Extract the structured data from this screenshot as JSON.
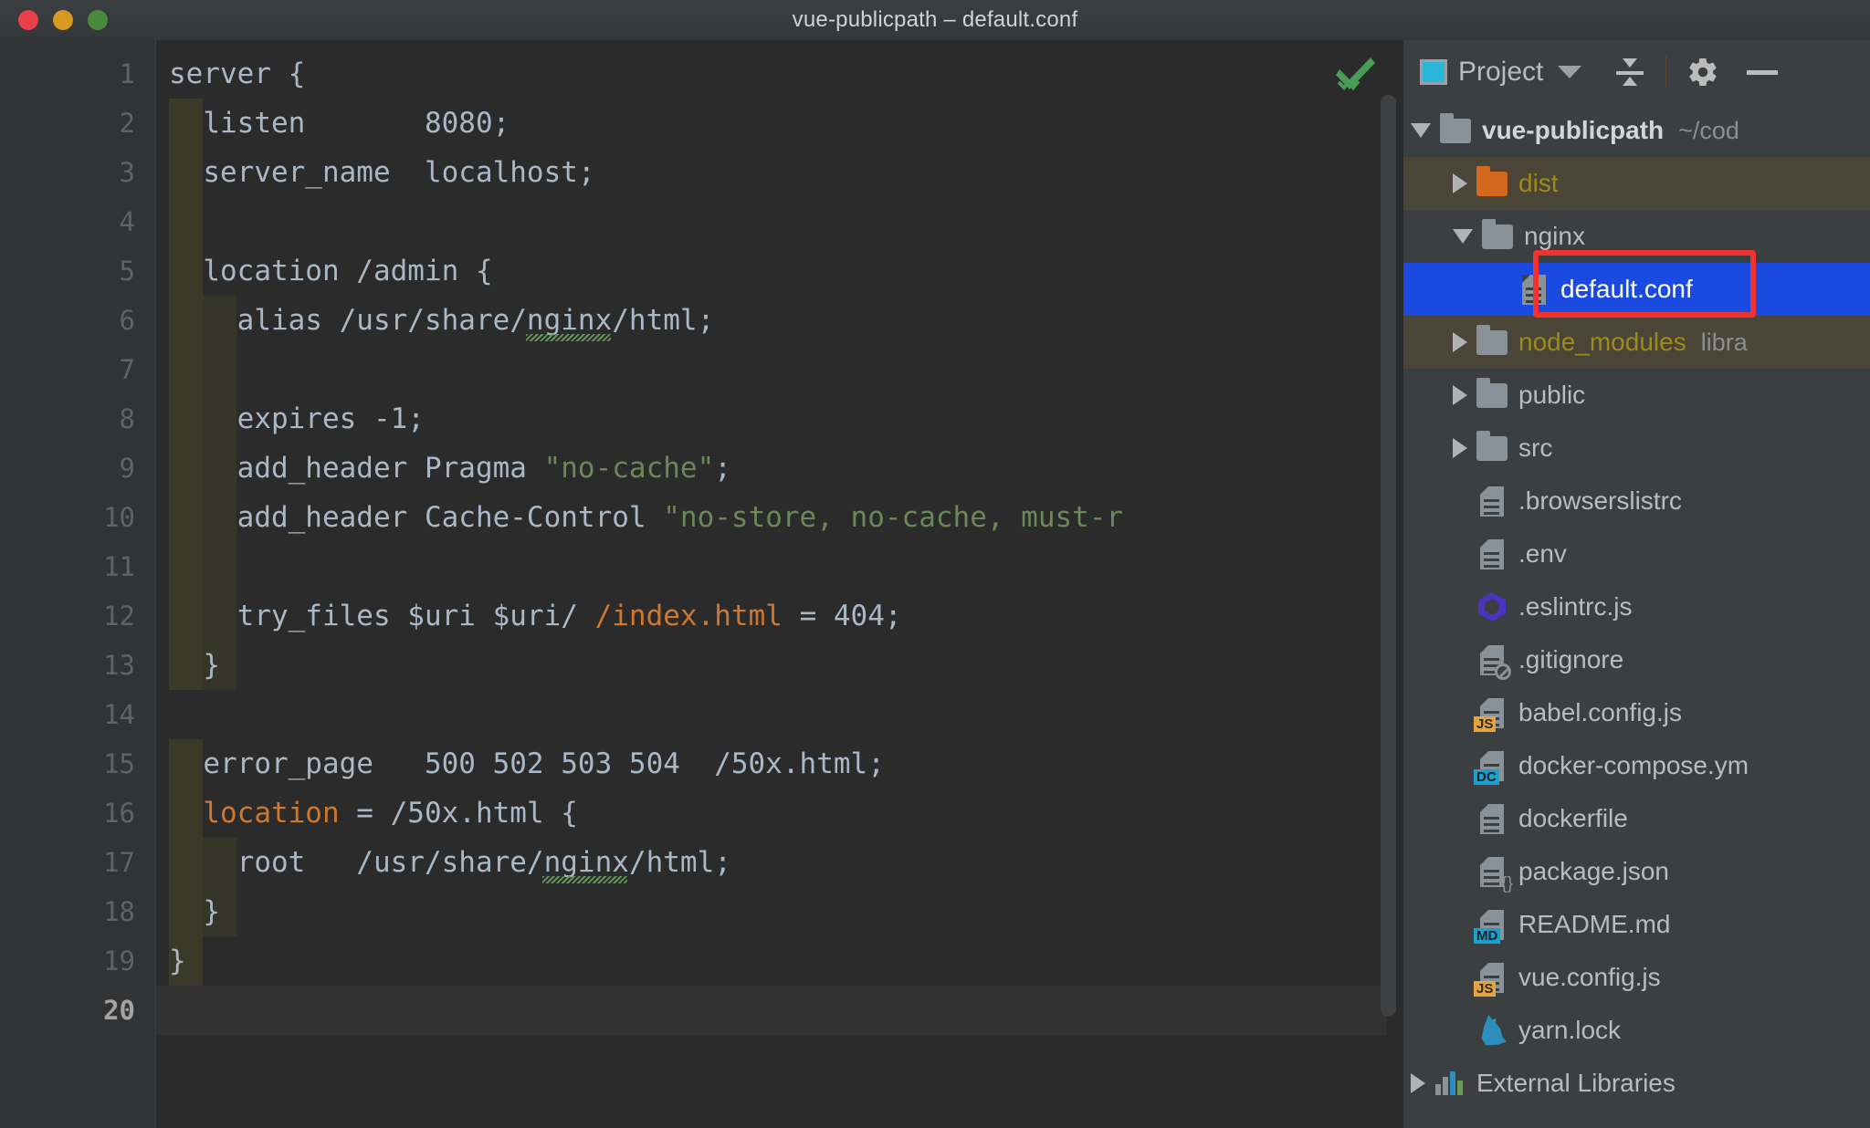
{
  "window": {
    "title": "vue-publicpath – default.conf",
    "traffic_lights": [
      "close-red",
      "minimize-yellow",
      "zoom-green"
    ]
  },
  "editor": {
    "filename": "default.conf",
    "language": "nginx",
    "current_line": 20,
    "total_lines": 20,
    "inspection_status": "ok",
    "line_numbers": [
      "1",
      "2",
      "3",
      "4",
      "5",
      "6",
      "7",
      "8",
      "9",
      "10",
      "11",
      "12",
      "13",
      "14",
      "15",
      "16",
      "17",
      "18",
      "19",
      "20"
    ],
    "lines": [
      {
        "n": 1,
        "text": "server {"
      },
      {
        "n": 2,
        "text": "    listen       8080;"
      },
      {
        "n": 3,
        "text": "    server_name  localhost;"
      },
      {
        "n": 4,
        "text": ""
      },
      {
        "n": 5,
        "text": "    location /admin {"
      },
      {
        "n": 6,
        "text": "        alias /usr/share/nginx/html;"
      },
      {
        "n": 7,
        "text": ""
      },
      {
        "n": 8,
        "text": "        expires -1;"
      },
      {
        "n": 9,
        "text": "        add_header Pragma \"no-cache\";"
      },
      {
        "n": 10,
        "text": "        add_header Cache-Control \"no-store, no-cache, must-r"
      },
      {
        "n": 11,
        "text": ""
      },
      {
        "n": 12,
        "text": "        try_files $uri $uri/ /index.html = 404;"
      },
      {
        "n": 13,
        "text": "    }"
      },
      {
        "n": 14,
        "text": ""
      },
      {
        "n": 15,
        "text": "    error_page   500 502 503 504  /50x.html;"
      },
      {
        "n": 16,
        "text": "    location = /50x.html {"
      },
      {
        "n": 17,
        "text": "        root   /usr/share/nginx/html;"
      },
      {
        "n": 18,
        "text": "    }"
      },
      {
        "n": 19,
        "text": "}"
      },
      {
        "n": 20,
        "text": ""
      }
    ],
    "tokens": {
      "line1": [
        "server",
        " {"
      ],
      "line2_key": "listen",
      "line2_val": "8080",
      "line2_semi": ";",
      "line3_key": "server_name",
      "line3_val": "localhost",
      "line3_semi": ";",
      "line5": "location /admin {",
      "line6": "alias /usr/share/nginx/html",
      "line6_semi": ";",
      "line8": "expires -1",
      "line8_semi": ";",
      "line9_a": "add_header Pragma ",
      "line9_str": "\"no-cache\"",
      "line9_semi": ";",
      "line10_a": "add_header Cache-Control ",
      "line10_str": "\"no-store, no-cache, must-r",
      "line12_a": "try_files $uri $uri/ ",
      "line12_path": "/index.html",
      "line12_b": " = 404",
      "line12_semi": ";",
      "line13": "}",
      "line15_a": "error_page   500 502 503 504  /50x.html",
      "line15_semi": ";",
      "line16_kw": "location",
      "line16_b": " = /50x.html {",
      "line17": "root   /usr/share/nginx/html",
      "line17_semi": ";",
      "line18": "}",
      "line19": "}"
    },
    "colors": {
      "background": "#2b2b2b",
      "gutter_background": "#313335",
      "text": "#a9b7c6",
      "string": "#6a8759",
      "keyword": "#cc7832",
      "line_number": "#606366",
      "current_line_number": "#a4a3a3",
      "indent_guide_tint": "#3b3a28",
      "inspection_check": "#499c54",
      "typo_squiggle": "#629755"
    },
    "typos": [
      "nginx (line 6)",
      "nginx (line 17)"
    ]
  },
  "project_panel": {
    "toolbar": {
      "title": "Project",
      "icons": [
        "project-view-icon",
        "chevron-down-icon",
        "collapse-all-icon",
        "gear-icon",
        "hide-icon"
      ]
    },
    "tree": [
      {
        "label": "vue-publicpath",
        "meta": "~/cod",
        "kind": "folder",
        "twist": "open",
        "depth": 0,
        "style": "bold",
        "row": "plain"
      },
      {
        "label": "dist",
        "meta": "",
        "kind": "folder-orange",
        "twist": "closed",
        "depth": 1,
        "style": "yellow",
        "row": "tan"
      },
      {
        "label": "nginx",
        "meta": "",
        "kind": "folder",
        "twist": "open",
        "depth": 1,
        "style": "normal",
        "row": "plain"
      },
      {
        "label": "default.conf",
        "meta": "",
        "kind": "file",
        "twist": "none",
        "depth": 2,
        "style": "white",
        "row": "selected"
      },
      {
        "label": "node_modules",
        "meta": "libra",
        "kind": "folder",
        "twist": "closed",
        "depth": 1,
        "style": "yellow",
        "row": "tan"
      },
      {
        "label": "public",
        "meta": "",
        "kind": "folder",
        "twist": "closed",
        "depth": 1,
        "style": "normal",
        "row": "plain"
      },
      {
        "label": "src",
        "meta": "",
        "kind": "folder",
        "twist": "closed",
        "depth": 1,
        "style": "normal",
        "row": "plain"
      },
      {
        "label": ".browserslistrc",
        "meta": "",
        "kind": "file",
        "twist": "none",
        "depth": 1,
        "style": "normal",
        "row": "plain"
      },
      {
        "label": ".env",
        "meta": "",
        "kind": "file",
        "twist": "none",
        "depth": 1,
        "style": "normal",
        "row": "plain"
      },
      {
        "label": ".eslintrc.js",
        "meta": "",
        "kind": "eslint",
        "twist": "none",
        "depth": 1,
        "style": "normal",
        "row": "plain"
      },
      {
        "label": ".gitignore",
        "meta": "",
        "kind": "file-git",
        "twist": "none",
        "depth": 1,
        "style": "normal",
        "row": "plain"
      },
      {
        "label": "babel.config.js",
        "meta": "",
        "kind": "file-js",
        "twist": "none",
        "depth": 1,
        "style": "normal",
        "row": "plain"
      },
      {
        "label": "docker-compose.ym",
        "meta": "",
        "kind": "file-dc",
        "twist": "none",
        "depth": 1,
        "style": "normal",
        "row": "plain"
      },
      {
        "label": "dockerfile",
        "meta": "",
        "kind": "file",
        "twist": "none",
        "depth": 1,
        "style": "normal",
        "row": "plain"
      },
      {
        "label": "package.json",
        "meta": "",
        "kind": "file-json",
        "twist": "none",
        "depth": 1,
        "style": "normal",
        "row": "plain"
      },
      {
        "label": "README.md",
        "meta": "",
        "kind": "file-md",
        "twist": "none",
        "depth": 1,
        "style": "normal",
        "row": "plain"
      },
      {
        "label": "vue.config.js",
        "meta": "",
        "kind": "file-js",
        "twist": "none",
        "depth": 1,
        "style": "normal",
        "row": "plain"
      },
      {
        "label": "yarn.lock",
        "meta": "",
        "kind": "yarn",
        "twist": "none",
        "depth": 1,
        "style": "normal",
        "row": "plain"
      },
      {
        "label": "External Libraries",
        "meta": "",
        "kind": "extlib",
        "twist": "closed",
        "depth": 0,
        "style": "normal",
        "row": "plain"
      }
    ],
    "selected_item": "default.conf",
    "colors": {
      "panel_background": "#3c3f41",
      "selection": "#1a4ae0",
      "tan_row": "#4b4538",
      "folder_yellow_text": "#9d8b19",
      "annotation_red": "#f2322e"
    }
  },
  "annotation": {
    "type": "red-rectangle-highlight",
    "target": "default.conf",
    "color": "#f2322e"
  }
}
